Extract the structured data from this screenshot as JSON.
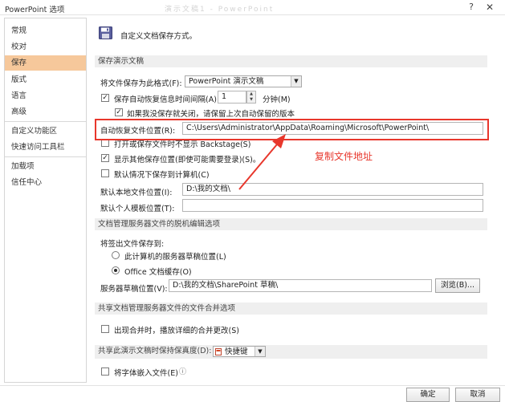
{
  "window": {
    "title": "PowerPoint 选项",
    "ghost_text": "演示文稿1 - PowerPoint",
    "help": "?",
    "close": "✕"
  },
  "sidebar": {
    "items": [
      "常规",
      "校对",
      "保存",
      "版式",
      "语言",
      "高级",
      "自定义功能区",
      "快速访问工具栏",
      "加载项",
      "信任中心"
    ]
  },
  "header": {
    "text": "自定义文档保存方式。"
  },
  "save_section": {
    "title": "保存演示文稿",
    "format_label": "将文件保存为此格式(F):",
    "format_value": "PowerPoint 演示文稿",
    "autosave_label": "保存自动恢复信息时间间隔(A)",
    "autosave_value": "1",
    "minutes_label": "分钟(M)",
    "keep_last_label": "如果我没保存就关闭，请保留上次自动保留的版本",
    "autorecover_label": "自动恢复文件位置(R):",
    "autorecover_value": "C:\\Users\\Administrator\\AppData\\Roaming\\Microsoft\\PowerPoint\\",
    "no_backstage_label": "打开或保存文件时不显示 Backstage(S)",
    "show_other_label": "显示其他保存位置(即使可能需要登录)(S)。",
    "default_computer_label": "默认情况下保存到计算机(C)",
    "default_local_label": "默认本地文件位置(I):",
    "default_local_value": "D:\\我的文档\\",
    "personal_template_label": "默认个人模板位置(T):",
    "personal_template_value": ""
  },
  "offline_section": {
    "title": "文档管理服务器文件的脱机编辑选项",
    "checkout_label": "将签出文件保存到:",
    "server_drafts_label": "此计算机的服务器草稿位置(L)",
    "office_cache_label": "Office 文档缓存(O)",
    "drafts_label": "服务器草稿位置(V):",
    "drafts_value": "D:\\我的文档\\SharePoint 草稿\\",
    "browse_label": "浏览(B)..."
  },
  "merge_section": {
    "title": "共享文档管理服务器文件的文件合并选项",
    "merge_label": "出现合并时，播放详细的合并更改(S)"
  },
  "fidelity_section": {
    "title": "共享此演示文稿时保持保真度(D):",
    "file_value": "快捷键",
    "embed_fonts_label": "将字体嵌入文件(E)",
    "info_icon": "ⓘ"
  },
  "annotation": {
    "text": "复制文件地址"
  },
  "footer": {
    "ok_label": "确定",
    "cancel_label": "取消"
  },
  "colors": {
    "accent_nav": "#f6c89b",
    "annotation_red": "#e8372c"
  }
}
